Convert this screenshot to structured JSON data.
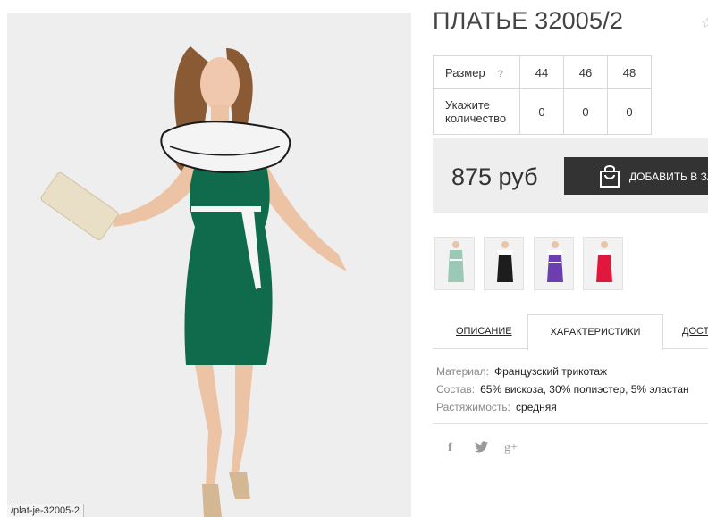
{
  "product": {
    "title": "ПЛАТЬЕ 32005/2",
    "price": "875 руб",
    "add_to_cart_label": "ДОБАВИТЬ В ЗА"
  },
  "status_url": "/plat-je-32005-2",
  "size_table": {
    "size_label": "Размер",
    "help_mark": "?",
    "qty_label_line1": "Укажите",
    "qty_label_line2": "количество",
    "sizes": [
      "44",
      "46",
      "48"
    ],
    "quantities": [
      "0",
      "0",
      "0"
    ]
  },
  "thumbnails": [
    {
      "name": "mint",
      "color": "#9cc9b6"
    },
    {
      "name": "black",
      "color": "#1d1d1d"
    },
    {
      "name": "purple",
      "color": "#6b3fb0"
    },
    {
      "name": "red",
      "color": "#e2173d"
    }
  ],
  "tabs": {
    "description": "ОПИСАНИЕ",
    "characteristics": "ХАРАКТЕРИСТИКИ",
    "delivery": "ДОСТ"
  },
  "specs": [
    {
      "key": "Материал:",
      "value": "Французский трикотаж"
    },
    {
      "key": "Состав:",
      "value": "65% вискоза, 30% полиэстер, 5% эластан"
    },
    {
      "key": "Растяжимость:",
      "value": "средняя"
    }
  ],
  "social": {
    "facebook": "f",
    "twitter": "🐦",
    "google_plus": "g+"
  },
  "colors": {
    "dress_main": "#0f6b4c",
    "button_dark": "#333333",
    "price_bg": "#eeeeee"
  }
}
